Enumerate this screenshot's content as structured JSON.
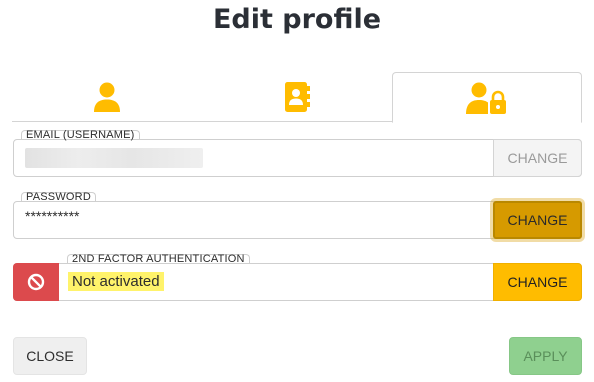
{
  "dialog": {
    "title": "Edit profile"
  },
  "tabs": [
    {
      "icon": "user-icon",
      "active": false
    },
    {
      "icon": "address-book-icon",
      "active": false
    },
    {
      "icon": "user-lock-icon",
      "active": true
    }
  ],
  "fields": {
    "email": {
      "legend": "EMAIL (USERNAME)",
      "value_obscured": true,
      "button": "CHANGE",
      "button_state": "disabled"
    },
    "password": {
      "legend": "PASSWORD",
      "value": "**********",
      "button": "CHANGE",
      "button_state": "focused"
    },
    "two_factor": {
      "legend": "2ND FACTOR AUTHENTICATION",
      "value": "Not activated",
      "status_icon": "ban-icon",
      "button": "CHANGE"
    }
  },
  "footer": {
    "close": "CLOSE",
    "apply": "APPLY"
  },
  "colors": {
    "accent": "#ffbc00",
    "danger": "#dc4a4d",
    "apply": "#8fd08f",
    "highlight": "#fff36b"
  }
}
